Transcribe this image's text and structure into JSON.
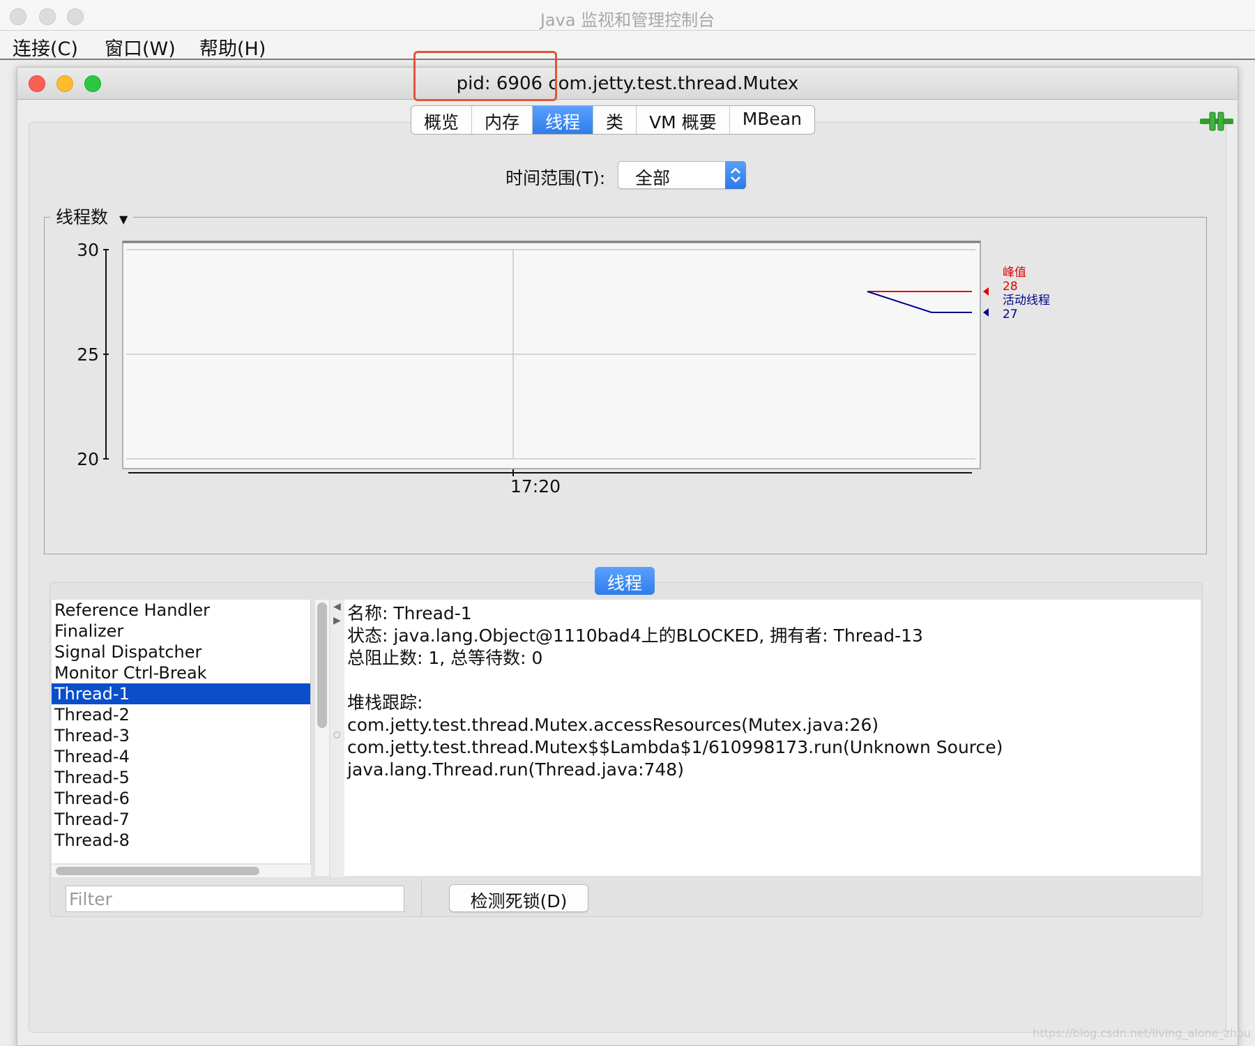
{
  "app": {
    "title": "Java 监视和管理控制台",
    "menu": [
      "连接(C)",
      "窗口(W)",
      "帮助(H)"
    ]
  },
  "window": {
    "title": "pid: 6906 com.jetty.test.thread.Mutex",
    "tabs": [
      "概览",
      "内存",
      "线程",
      "类",
      "VM 概要",
      "MBean"
    ],
    "active_tab": "线程"
  },
  "time_range": {
    "label": "时间范围(T):",
    "value": "全部"
  },
  "chart_group_label": "线程数",
  "chart_data": {
    "type": "line",
    "y_ticks": [
      "30",
      "25",
      "20"
    ],
    "ylim": [
      20,
      30
    ],
    "x_ticks": [
      "17:20"
    ],
    "series": [
      {
        "name": "峰值",
        "value_label": "28",
        "color": "#e00000",
        "y": [
          28,
          28,
          28
        ]
      },
      {
        "name": "活动线程",
        "value_label": "27",
        "color": "#00008b",
        "y": [
          28,
          27,
          27
        ]
      }
    ]
  },
  "threads": {
    "section_label": "线程",
    "list": [
      "Reference Handler",
      "Finalizer",
      "Signal Dispatcher",
      "Monitor Ctrl-Break",
      "Thread-1",
      "Thread-2",
      "Thread-3",
      "Thread-4",
      "Thread-5",
      "Thread-6",
      "Thread-7",
      "Thread-8"
    ],
    "selected": "Thread-1",
    "detail": {
      "name_line": "名称: Thread-1",
      "state_line": "状态: java.lang.Object@1110bad4上的BLOCKED, 拥有者: Thread-13",
      "counts_line": "总阻止数: 1, 总等待数: 0",
      "stack_header": "堆栈跟踪:",
      "stack": [
        "com.jetty.test.thread.Mutex.accessResources(Mutex.java:26)",
        "com.jetty.test.thread.Mutex$$Lambda$1/610998173.run(Unknown Source)",
        "java.lang.Thread.run(Thread.java:748)"
      ]
    },
    "filter_placeholder": "Filter",
    "deadlock_button": "检测死锁(D)"
  },
  "watermark": "https://blog.csdn.net/living_alone_zhou"
}
